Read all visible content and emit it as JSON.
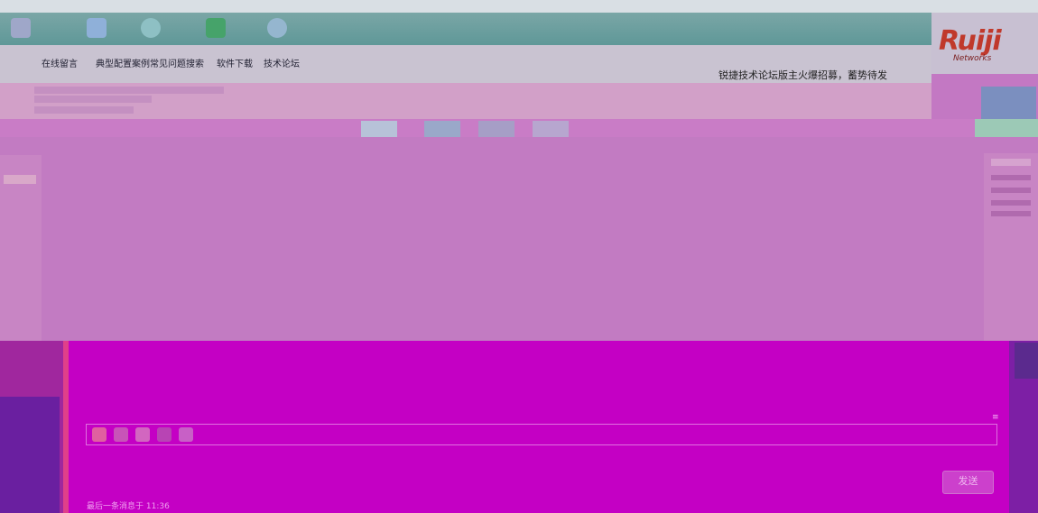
{
  "colors": {
    "banner": "#5f9898",
    "nav_bg": "#c9c3d1",
    "main_bg": "#c27bc2",
    "lower_bg": "#c400c4",
    "logo_red": "#c0392b"
  },
  "logo": {
    "brand": "Ruiji",
    "subtitle": "Networks"
  },
  "nav": {
    "items": [
      {
        "label": "在线留言"
      },
      {
        "label": "典型配置案例"
      },
      {
        "label": "常见问题搜索"
      },
      {
        "label": "软件下载"
      },
      {
        "label": "技术论坛"
      }
    ],
    "notice": "锐捷技术论坛版主火爆招募，蓄势待发"
  },
  "chat": {
    "send_label": "发送",
    "footer": "最后一条消息于 11:36"
  }
}
